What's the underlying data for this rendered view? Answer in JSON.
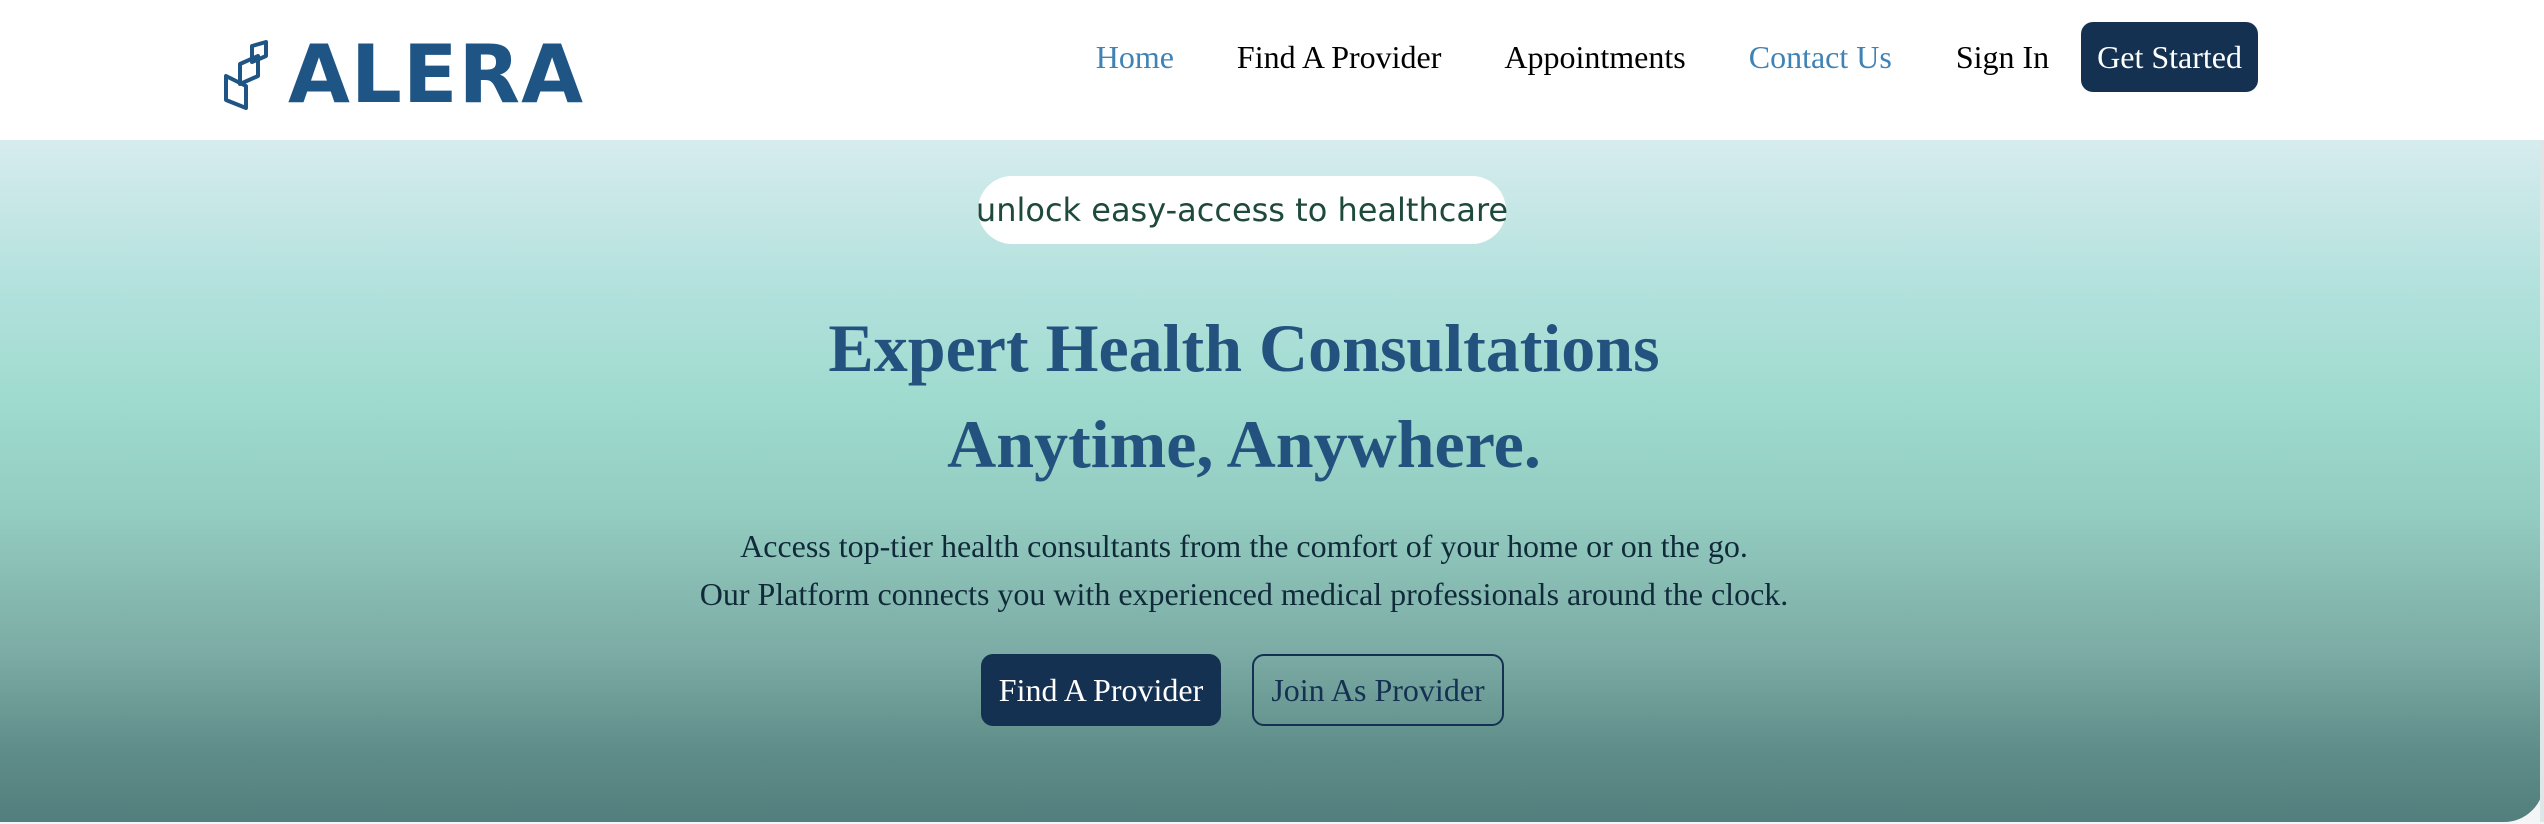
{
  "brand": {
    "name": "ALERA",
    "logo_icon": "leaf-sprout-icon",
    "color": "#1f5585"
  },
  "nav": {
    "items": [
      {
        "label": "Home",
        "active": true
      },
      {
        "label": "Find A Provider"
      },
      {
        "label": "Appointments"
      },
      {
        "label": "Contact Us",
        "highlighted": true
      },
      {
        "label": "Sign In"
      }
    ],
    "cta_label": "Get Started"
  },
  "hero": {
    "tagline": "unlock easy-access to healthcare",
    "headline_line1": "Expert Health Consultations",
    "headline_line2": "Anytime, Anywhere.",
    "description_line1": "Access top-tier health consultants from the comfort of your home or on the go.",
    "description_line2": "Our Platform connects you with experienced medical professionals around the clock.",
    "primary_button": "Find A Provider",
    "secondary_button": "Join As Provider"
  },
  "colors": {
    "navy": "#143152",
    "accent_link": "#3f82b5",
    "headline": "#24527e"
  }
}
